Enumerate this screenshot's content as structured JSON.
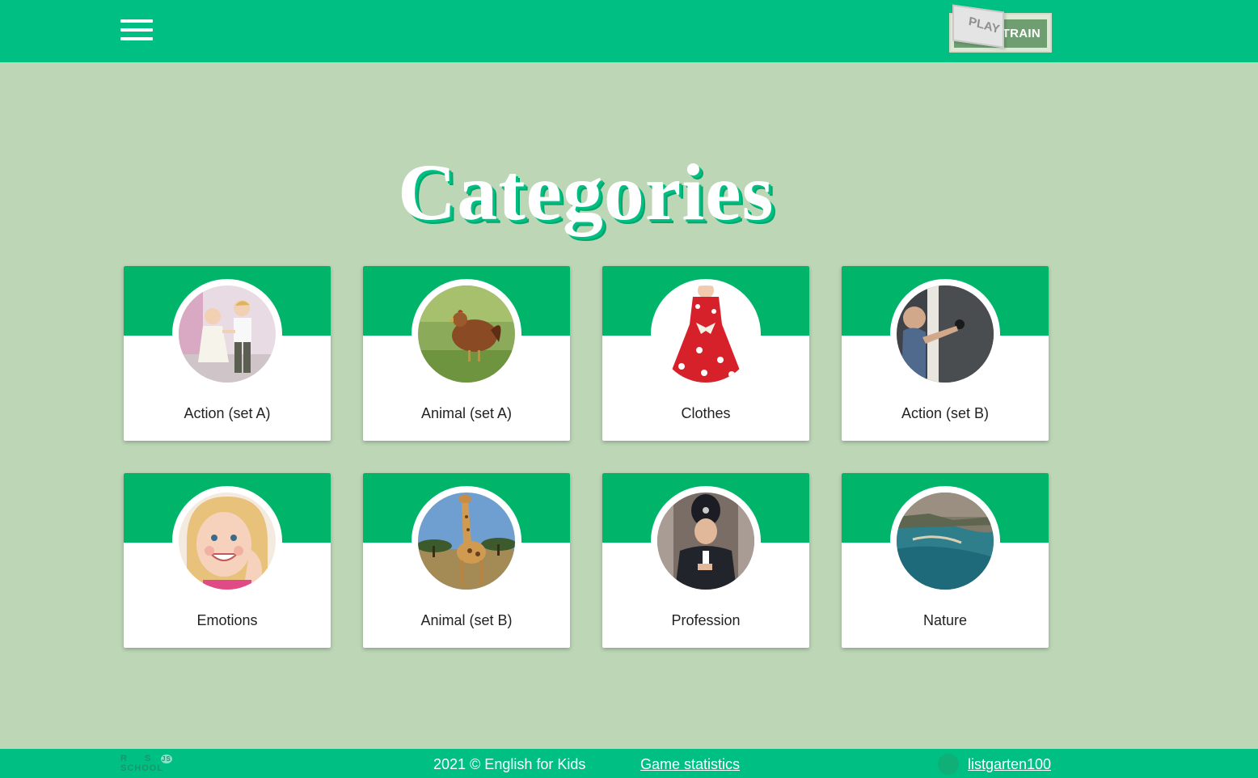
{
  "header": {
    "menu_icon": "hamburger-menu-icon",
    "mode_switch": {
      "play_label": "PLAY",
      "train_label": "TRAIN"
    }
  },
  "main": {
    "title": "Categories",
    "categories": [
      {
        "label": "Action (set A)",
        "image": "children-dancing"
      },
      {
        "label": "Animal (set A)",
        "image": "hen"
      },
      {
        "label": "Clothes",
        "image": "red-dress"
      },
      {
        "label": "Action (set B)",
        "image": "child-opening-door"
      },
      {
        "label": "Emotions",
        "image": "smiling-girl"
      },
      {
        "label": "Animal (set B)",
        "image": "giraffe"
      },
      {
        "label": "Profession",
        "image": "police-officer"
      },
      {
        "label": "Nature",
        "image": "river-landscape"
      }
    ]
  },
  "footer": {
    "logo_text": [
      "R",
      "S",
      "SCHOOL",
      "JS"
    ],
    "copyright": "2021 © English for Kids",
    "stats_link": "Game statistics",
    "user_link": "listgarten100",
    "github_icon": "github-icon"
  },
  "colors": {
    "background": "#bcd6b6",
    "header": "#00bf82",
    "card_top": "#00b56a",
    "text": "#222222"
  }
}
